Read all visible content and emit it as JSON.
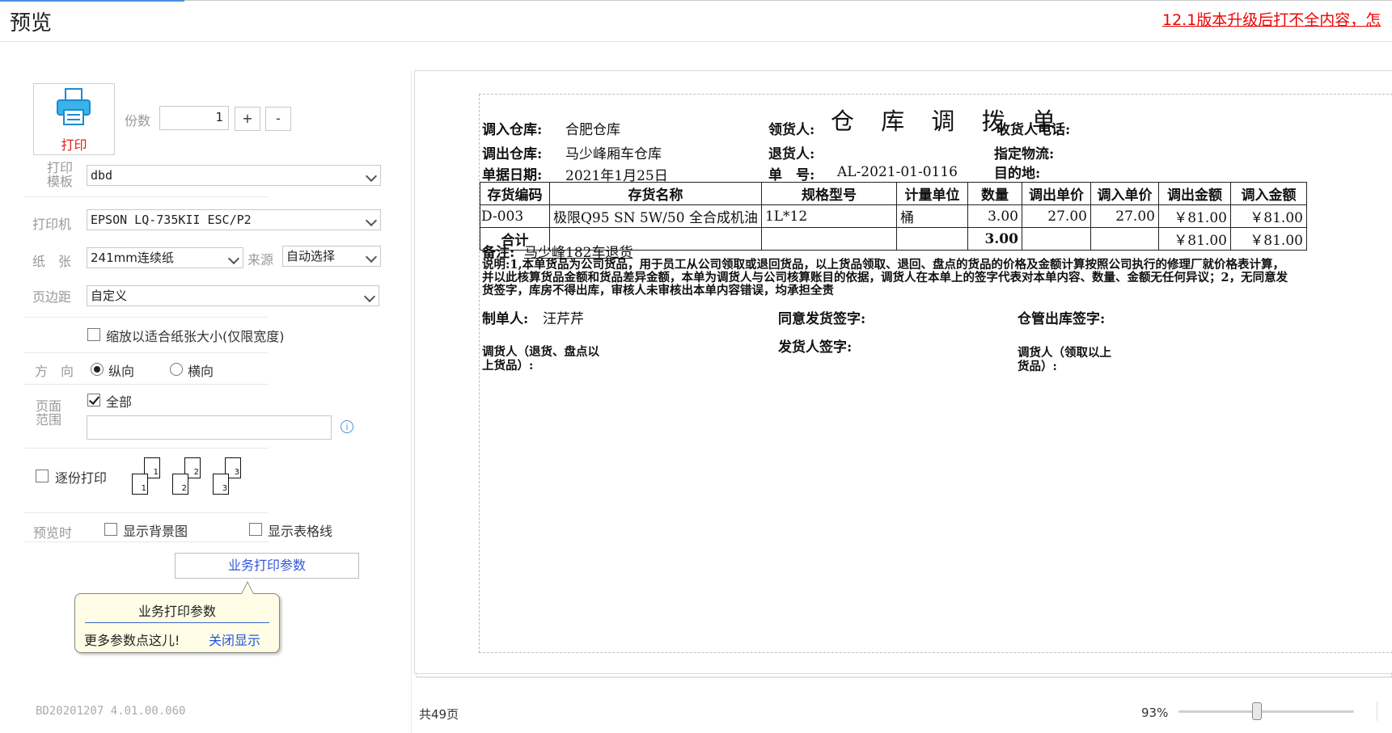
{
  "header": {
    "title": "预览",
    "notice": "12.1版本升级后打不全内容，怎"
  },
  "left": {
    "print_label": "打印",
    "copies_label": "份数",
    "copies_value": "1",
    "plus_label": "+",
    "minus_label": "-",
    "template_label_1": "打印",
    "template_label_2": "模板",
    "template_value": "dbd",
    "printer_label": "打印机",
    "printer_value": "EPSON LQ-735KII ESC/P2",
    "paper_label": "纸　张",
    "paper_value": "241mm连续纸",
    "source_label": "来源",
    "source_value": "自动选择",
    "margin_label": "页边距",
    "margin_value": "自定义",
    "fit_label": "缩放以适合纸张大小(仅限宽度)",
    "orientation_label": "方　向",
    "portrait_label": "纵向",
    "landscape_label": "横向",
    "range_label_1": "页面",
    "range_label_2": "范围",
    "all_label": "全部",
    "range_value": "",
    "collate_label": "逐份打印",
    "preview_label": "预览时",
    "show_bg_label": "显示背景图",
    "show_grid_label": "显示表格线",
    "biz_params_label": "业务打印参数",
    "tip_title": "业务打印参数",
    "tip_text": "更多参数点这儿!",
    "tip_close": "关闭显示",
    "version": "BD20201207 4.01.00.060"
  },
  "doc": {
    "title": "仓 库 调 拨 单",
    "in_wh_label": "调入仓库:",
    "in_wh_value": "合肥仓库",
    "receiver_label": "领货人:",
    "receiver_phone_label": "收货人电话:",
    "out_wh_label": "调出仓库:",
    "out_wh_value": "马少峰厢车仓库",
    "returner_label": "退货人:",
    "logistics_label": "指定物流:",
    "date_label": "单据日期:",
    "date_value": "2021年1月25日",
    "no_label": "单　号:",
    "no_value": "AL-2021-01-0116",
    "dest_label": "目的地:",
    "columns": [
      "存货编码",
      "存货名称",
      "规格型号",
      "计量单位",
      "数量",
      "调出单价",
      "调入单价",
      "调出金额",
      "调入金额"
    ],
    "rows": [
      [
        "D-003",
        "极限Q95 SN 5W/50 全合成机油",
        "1L*12",
        "桶",
        "3.00",
        "27.00",
        "27.00",
        "￥81.00",
        "￥81.00"
      ]
    ],
    "total_label": "合计",
    "total_qty": "3.00",
    "total_out_amount": "￥81.00",
    "total_in_amount": "￥81.00",
    "remark_label": "备注:",
    "remark_value": "马少峰182车退货",
    "note": "说明:1,本单货品为公司货品，用于员工从公司领取或退回货品，以上货品领取、退回、盘点的货品的价格及金额计算按照公司执行的修理厂就价格表计算，并以此核算货品金额和货品差异金额，本单为调货人与公司核算账目的依据，调货人在本单上的签字代表对本单内容、数量、金额无任何异议；2，无同意发货签字，库房不得出库，审核人未审核出本单内容错误，均承担全责",
    "maker_label": "制单人:",
    "maker_value": "汪芹芹",
    "agree_label": "同意发货签字:",
    "wh_out_label": "仓管出库签字:",
    "adjuster_label": "调货人（退货、盘点以上货品）:",
    "shipper_label": "发货人签字:",
    "adjuster2_label": "调货人（领取以上货品）:"
  },
  "footer": {
    "pages": "共49页",
    "zoom": "93%",
    "zoom_value": 0.93
  }
}
